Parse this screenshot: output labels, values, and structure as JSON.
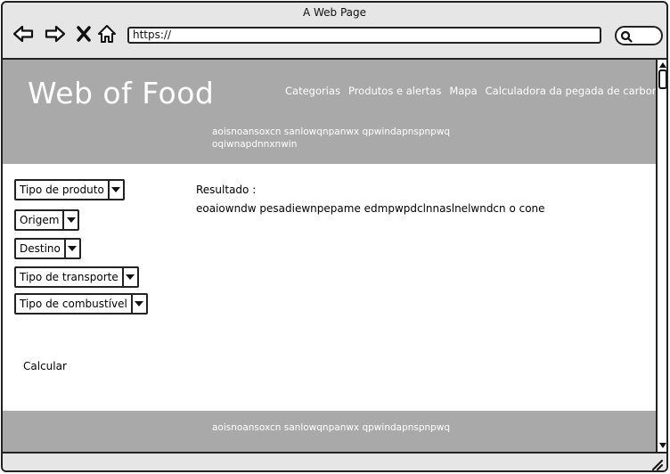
{
  "window": {
    "title": "A Web Page"
  },
  "browser": {
    "url": "https://"
  },
  "site": {
    "brand": "Web of Food",
    "nav": [
      "Categorias",
      "Produtos e alertas",
      "Mapa",
      "Calculadora da pegada de carbono"
    ],
    "header_text": "aoisnoansoxcn sanlowqnpanwx  qpwindapnspnpwq oqiwnapdnnxnwin"
  },
  "filters": [
    {
      "label": "Tipo de produto"
    },
    {
      "label": "Origem"
    },
    {
      "label": "Destino"
    },
    {
      "label": "Tipo de transporte"
    },
    {
      "label": "Tipo de combustível"
    }
  ],
  "calculate_label": "Calcular",
  "result": {
    "label": "Resultado :",
    "text": "eoaiowndw pesadiewnpepame edmpwpdclnnaslnelwndcn o cone"
  },
  "footer": {
    "text": "aoisnoansoxcn sanlowqnpanwx  qpwindapnspnpwq"
  }
}
